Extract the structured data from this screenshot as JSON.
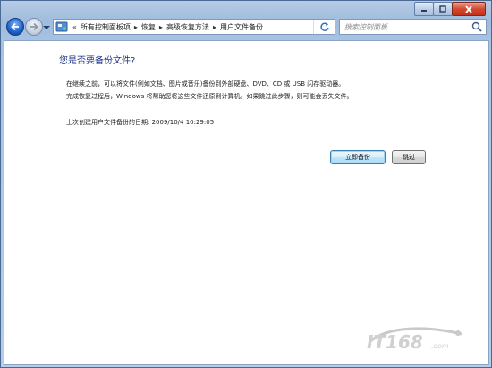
{
  "window": {
    "controls": [
      "minimize-icon",
      "maximize-icon",
      "close-icon"
    ]
  },
  "address_bar": {
    "overflow_chevron": "«",
    "breadcrumbs": [
      "所有控制面板项",
      "恢复",
      "高级恢复方法",
      "用户文件备份"
    ],
    "separator": "▸"
  },
  "search": {
    "placeholder": "搜索控制面板"
  },
  "main": {
    "heading": "您是否要备份文件?",
    "paragraph1": "在继续之前，可以将文件(例如文档、图片或音乐)备份到外部硬盘、DVD、CD 或 USB 闪存驱动器。",
    "paragraph2": "完成恢复过程后，Windows 将帮助您将这些文件还原到计算机。如果跳过此步骤，则可能会丢失文件。",
    "last_backup_label": "上次创建用户文件备份的日期:",
    "last_backup_value": "2009/10/4 10:29:05",
    "backup_now_button": "立即备份",
    "skip_button": "跳过"
  },
  "watermark": {
    "text": "IT168.com"
  },
  "colors": {
    "heading": "#1e3287",
    "frame": "#a8c3e2",
    "close_button": "#c53118"
  }
}
